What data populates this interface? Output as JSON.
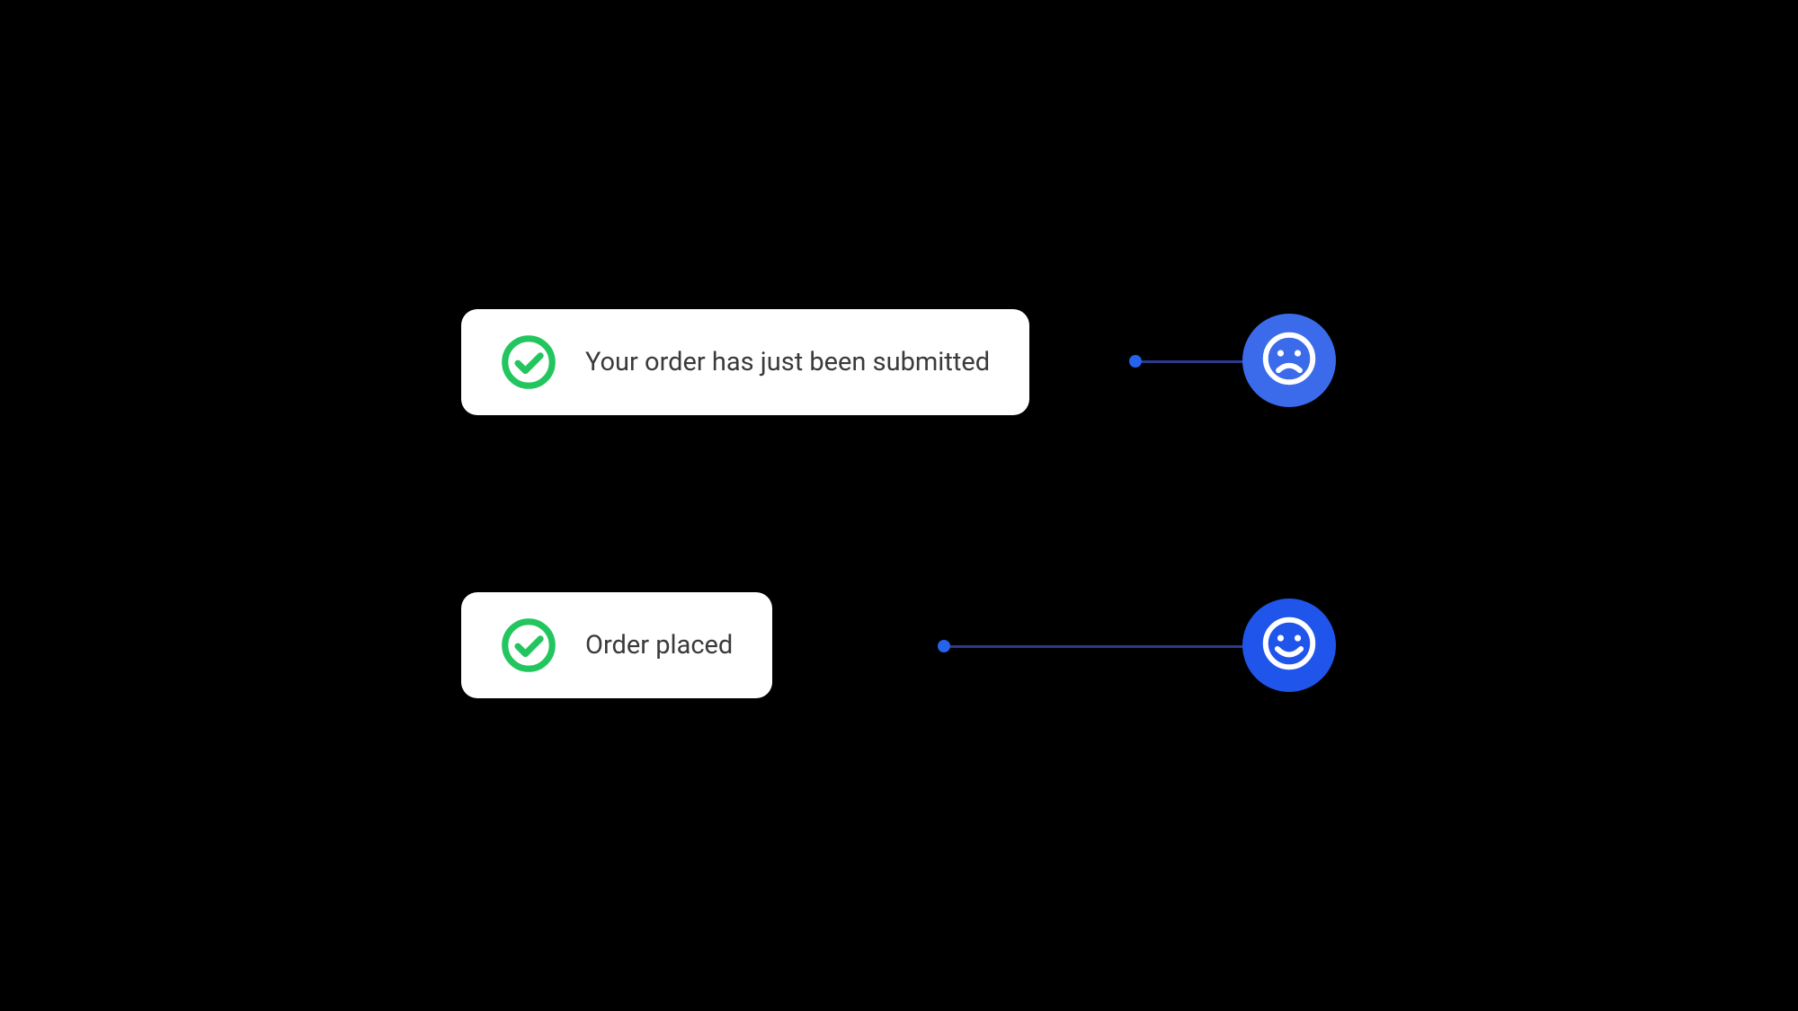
{
  "notifications": [
    {
      "text": "Your order has just been submitted",
      "icon": "check-circle",
      "mood": "sad"
    },
    {
      "text": "Order placed",
      "icon": "check-circle",
      "mood": "happy"
    }
  ],
  "colors": {
    "success_green": "#22c55e",
    "card_text": "#3a3a3a",
    "badge_blue_light": "#3b6beb",
    "badge_blue_dark": "#1f55eb",
    "connector_blue": "#2563eb",
    "connector_line": "#2a3a8f"
  }
}
